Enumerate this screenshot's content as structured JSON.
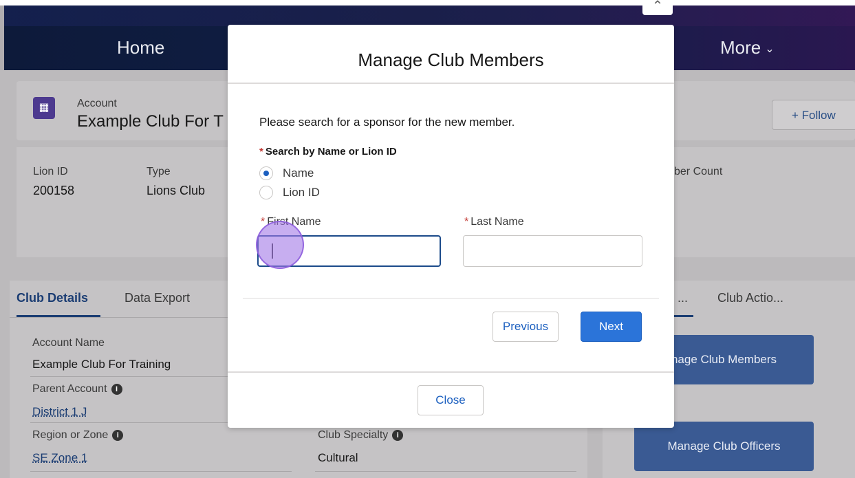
{
  "nav": {
    "home": "Home",
    "more": "More"
  },
  "account": {
    "label": "Account",
    "name": "Example Club For T",
    "follow": "Follow"
  },
  "fields": {
    "lion_id_label": "Lion ID",
    "lion_id_value": "200158",
    "type_label": "Type",
    "type_value": "Lions Club",
    "member_count_label": "ber Count"
  },
  "tabs": {
    "club_details": "Club Details",
    "data_export": "Data Export"
  },
  "details": {
    "account_name_label": "Account Name",
    "account_name_value": "Example Club For Training",
    "parent_account_label": "Parent Account",
    "parent_account_value": "District 1 J",
    "region_label": "Region or Zone",
    "region_value": "SE Zone 1",
    "specialty_label": "Club Specialty",
    "specialty_value": "Cultural"
  },
  "right_tabs": {
    "tab1": "...",
    "tab2": "Club Actio..."
  },
  "actions": {
    "manage_members": "nage Club Members",
    "manage_officers": "Manage Club Officers"
  },
  "modal": {
    "title": "Manage Club Members",
    "prompt": "Please search for a sponsor for the new member.",
    "search_label": "Search by Name or Lion ID",
    "options": [
      "Name",
      "Lion ID"
    ],
    "first_name_label": "First Name",
    "last_name_label": "Last Name",
    "first_name_value": "",
    "last_name_value": "",
    "previous": "Previous",
    "next": "Next",
    "close": "Close"
  },
  "colors": {
    "brand": "#1b73e8",
    "nav": "#0d1a3a",
    "required": "#c23934"
  }
}
